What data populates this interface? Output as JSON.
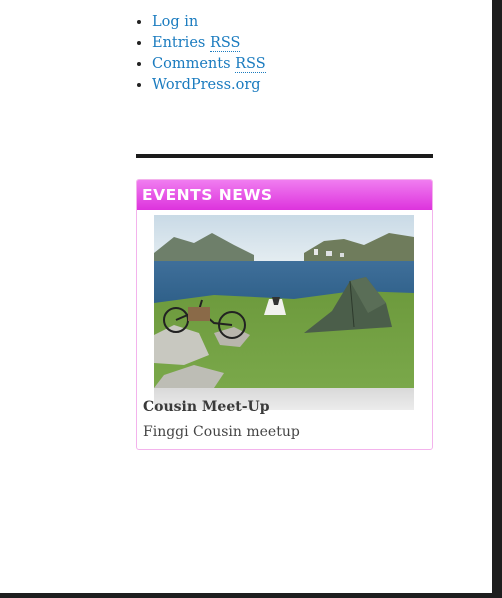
{
  "meta_links": [
    {
      "text": "Log in",
      "abbr": ""
    },
    {
      "text": "Entries ",
      "abbr": "RSS"
    },
    {
      "text": "Comments ",
      "abbr": "RSS"
    },
    {
      "text": "WordPress.org",
      "abbr": ""
    }
  ],
  "events_widget": {
    "title": "EVENTS NEWS",
    "post_title": "Cousin Meet-Up",
    "excerpt": "Finggi Cousin meetup"
  },
  "colors": {
    "accent": "#e04ae0",
    "link": "#1a7bbf"
  }
}
